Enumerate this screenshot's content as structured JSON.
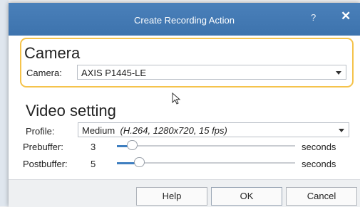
{
  "window": {
    "title": "Create Recording Action",
    "help_glyph": "?",
    "close_glyph": "✕"
  },
  "camera_group": {
    "title": "Camera",
    "camera_label": "Camera:",
    "camera_value": "AXIS P1445-LE"
  },
  "video_group": {
    "title": "Video setting",
    "profile_label": "Profile:",
    "profile_value": "Medium",
    "profile_detail": "(H.264, 1280x720, 15 fps)",
    "prebuffer": {
      "label": "Prebuffer:",
      "value": "3",
      "unit": "seconds",
      "level": 0.06
    },
    "postbuffer": {
      "label": "Postbuffer:",
      "value": "5",
      "unit": "seconds",
      "level": 0.1
    }
  },
  "buttons": {
    "help": "Help",
    "ok": "OK",
    "cancel": "Cancel"
  },
  "colors": {
    "titlebar": "#3f75b0",
    "highlight_border": "#f5c34b",
    "slider_fill": "#3f7fc0"
  },
  "icons": {
    "dropdown": "chevron-down-icon",
    "cursor": "mouse-pointer-icon"
  }
}
